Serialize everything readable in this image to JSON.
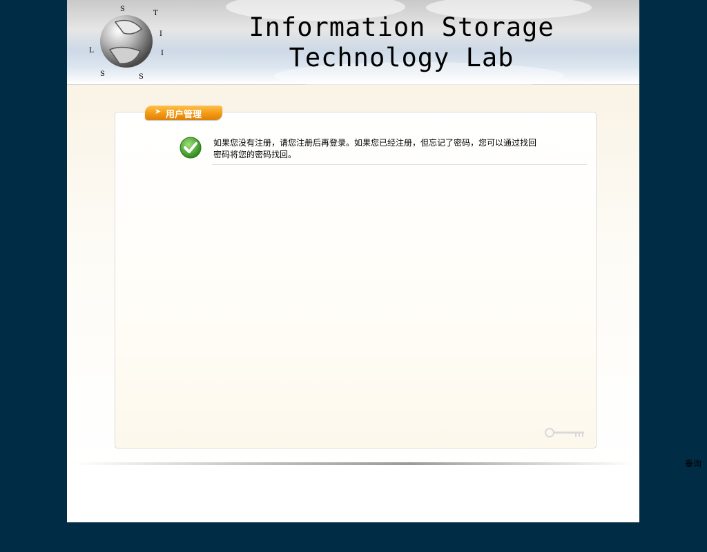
{
  "header": {
    "title": "Information Storage Technology Lab",
    "logo_letters": [
      "L",
      "S",
      "T",
      "I",
      "I",
      "S",
      "S"
    ]
  },
  "panel": {
    "tab_icon": "arrow-right-icon",
    "tab_label": "用户管理",
    "message": "如果您没有注册，请您注册后再登录。如果您已经注册，但忘记了密码，您可以通过找回密码将您的密码找回。",
    "message_icon": "check-circle-icon",
    "decoration_icon": "key-icon"
  },
  "outside_text": "垂询",
  "colors": {
    "background": "#002d45",
    "tab_orange": "#f39a14",
    "check_green": "#3fa12a"
  }
}
